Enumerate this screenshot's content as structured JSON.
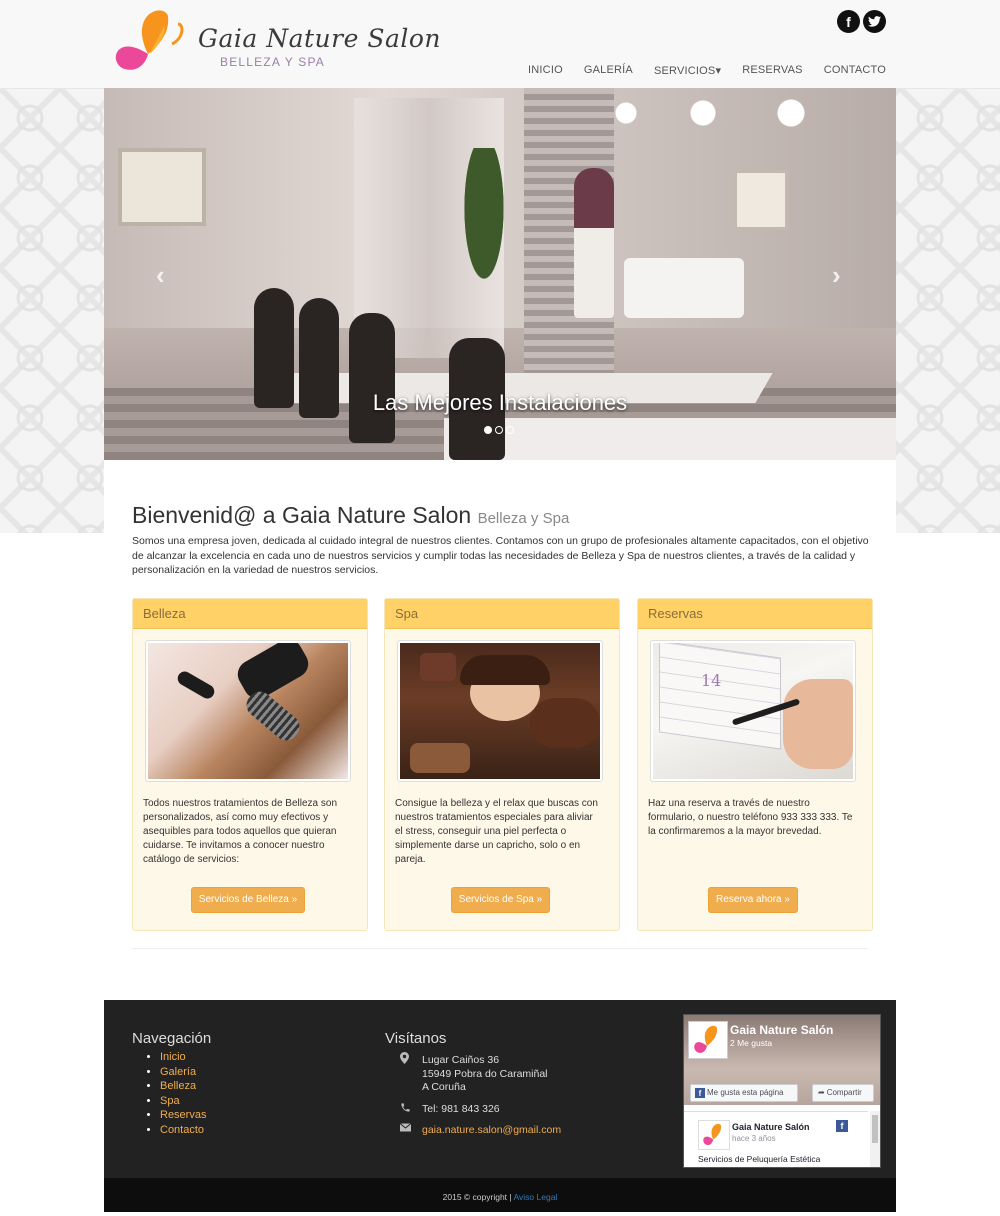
{
  "brand": {
    "title": "Gaia Nature Salon",
    "subtitle": "BELLEZA Y SPA",
    "colors": {
      "accent": "#f0ad4e",
      "panel_header": "#ffd166",
      "butterfly_orange": "#f7941d",
      "butterfly_pink": "#ec4899"
    }
  },
  "social": {
    "facebook": "f",
    "twitter": "t"
  },
  "nav": {
    "items": [
      "INICIO",
      "GALERÍA",
      "SERVICIOS",
      "RESERVAS",
      "CONTACTO"
    ],
    "dropdown_caret": "▾"
  },
  "carousel": {
    "caption": "Las Mejores Instalaciones",
    "prev_icon": "‹",
    "next_icon": "›",
    "slides_total": 3,
    "active_slide": 1
  },
  "welcome": {
    "heading": "Bienvenid@ a Gaia Nature Salon",
    "heading_small": "Belleza y Spa",
    "text": "Somos una empresa joven, dedicada al cuidado integral de nuestros clientes. Contamos con un grupo de profesionales altamente capacitados, con el objetivo de alcanzar la excelencia en cada uno de nuestros servicios y cumplir todas las necesidades de Belleza y Spa de nuestros clientes, a través de la calidad y personalización en la variedad de nuestros servicios."
  },
  "panels": [
    {
      "title": "Belleza",
      "text": "Todos nuestros tratamientos de Belleza son personalizados, así como muy efectivos y asequibles para todos aquellos que quieran cuidarse. Te invitamos a conocer nuestro catálogo de servicios:",
      "button": "Servicios de Belleza »"
    },
    {
      "title": "Spa",
      "text": "Consigue la belleza y el relax que buscas con nuestros tratamientos especiales para aliviar el stress, conseguir una piel perfecta o simplemente darse un capricho, solo o en pareja.",
      "button": "Servicios de Spa »"
    },
    {
      "title": "Reservas",
      "text": "Haz una reserva a través de nuestro formulario, o nuestro teléfono 933 333 333. Te la confirmaremos a la mayor brevedad.",
      "button": "Reserva ahora »"
    }
  ],
  "footer": {
    "nav_title": "Navegación",
    "nav_items": [
      "Inicio",
      "Galería",
      "Belleza",
      "Spa",
      "Reservas",
      "Contacto"
    ],
    "visit_title": "Visítanos",
    "address": [
      "Lugar Caiños 36",
      "15949 Pobra do Caramiñal",
      "A Coruña"
    ],
    "phone": "Tel: 981 843 326",
    "email": "gaia.nature.salon@gmail.com",
    "icons": {
      "location": "map-marker-icon",
      "phone": "phone-icon",
      "email": "envelope-icon"
    }
  },
  "facebook_widget": {
    "page_name": "Gaia Nature Salón",
    "likes": "2 Me gusta",
    "like_button": "Me gusta esta página",
    "share_button": "Compartir",
    "post_name": "Gaia Nature Salón",
    "post_time": "hace 3 años",
    "post_text": "Servicios de Peluquería Estética"
  },
  "copyright": {
    "text": "2015 © copyright |",
    "link": "Aviso Legal"
  }
}
